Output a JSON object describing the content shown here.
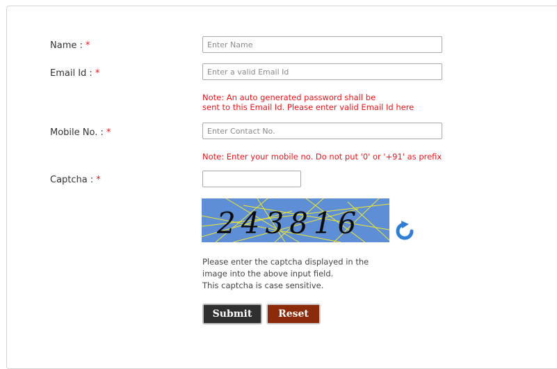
{
  "form": {
    "name": {
      "label": "Name :",
      "required_mark": "*",
      "placeholder": "Enter Name",
      "value": ""
    },
    "email": {
      "label": "Email Id :",
      "required_mark": "*",
      "placeholder": "Enter a valid Email Id",
      "value": "",
      "note_line1": "Note: An auto generated password shall be",
      "note_line2": "sent to this Email Id. Please enter valid Email Id here"
    },
    "mobile": {
      "label": "Mobile No. :",
      "required_mark": "*",
      "placeholder": "Enter Contact No.",
      "value": "",
      "note": "Note: Enter your mobile no. Do not put '0' or '+91' as prefix"
    },
    "captcha": {
      "label": "Captcha :",
      "required_mark": "*",
      "value": "",
      "image_text": "243816",
      "refresh_icon": "refresh-icon",
      "help_line1": "Please enter the captcha displayed in the",
      "help_line2": "image into the above input field.",
      "help_line3": "This captcha is case sensitive."
    }
  },
  "buttons": {
    "submit_label": "Submit",
    "reset_label": "Reset"
  },
  "colors": {
    "required": "#e8141b",
    "note": "#e8141b",
    "captcha_bg": "#5e8ed6",
    "captcha_lines": "#f2ea2a",
    "submit_bg": "#2f2f2f",
    "reset_bg": "#8c2a0c",
    "refresh_icon": "#2f7fd6"
  }
}
